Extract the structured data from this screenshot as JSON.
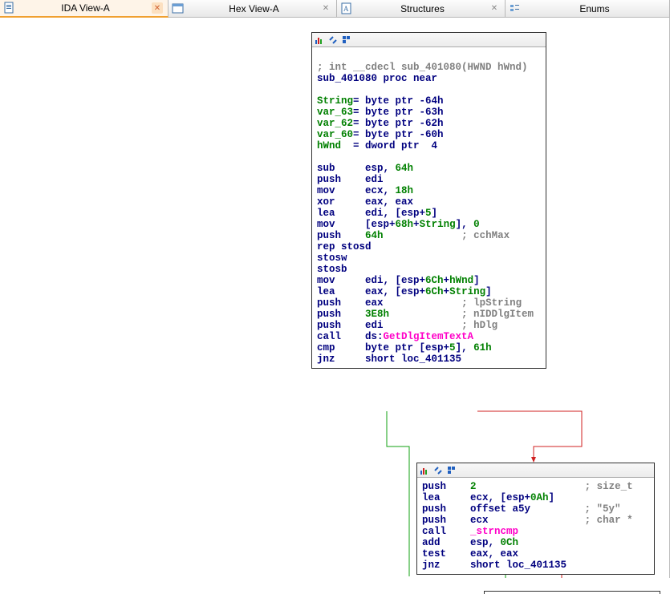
{
  "tabs": [
    {
      "label": "IDA View-A",
      "active": true
    },
    {
      "label": "Hex View-A",
      "active": false
    },
    {
      "label": "Structures",
      "active": false
    },
    {
      "label": "Enums",
      "active": false
    }
  ],
  "node1": {
    "sig_comment": "; int __cdecl sub_401080(HWND hWnd)",
    "proc_decl": "sub_401080 proc near",
    "vars": [
      {
        "name": "String",
        "eq": "= byte ptr -64h"
      },
      {
        "name": "var_63",
        "eq": "= byte ptr -63h"
      },
      {
        "name": "var_62",
        "eq": "= byte ptr -62h"
      },
      {
        "name": "var_60",
        "eq": "= byte ptr -60h"
      },
      {
        "name": "hWnd",
        "eq": "= dword ptr  4"
      }
    ],
    "lines": [
      {
        "m": "sub",
        "o": "esp, ",
        "n": "64h"
      },
      {
        "m": "push",
        "o": "edi"
      },
      {
        "m": "mov",
        "o": "ecx, ",
        "n": "18h"
      },
      {
        "m": "xor",
        "o": "eax, eax"
      },
      {
        "m": "lea",
        "o": "edi, [esp+",
        "n": "5",
        "o2": "]"
      },
      {
        "m": "mov",
        "o": "[esp+",
        "n": "68h",
        "o2": "+",
        "v": "String",
        "o3": "], ",
        "n2": "0"
      },
      {
        "m": "push",
        "n": "64h",
        "cmt": "; cchMax"
      },
      {
        "m": "rep stosd"
      },
      {
        "m": "stosw"
      },
      {
        "m": "stosb"
      },
      {
        "m": "mov",
        "o": "edi, [esp+",
        "n": "6Ch",
        "o2": "+",
        "v": "hWnd",
        "o3": "]"
      },
      {
        "m": "lea",
        "o": "eax, [esp+",
        "n": "6Ch",
        "o2": "+",
        "v": "String",
        "o3": "]"
      },
      {
        "m": "push",
        "o": "eax",
        "cmt": "; lpString"
      },
      {
        "m": "push",
        "n": "3E8h",
        "cmt": "; nIDDlgItem"
      },
      {
        "m": "push",
        "o": "edi",
        "cmt": "; hDlg"
      },
      {
        "m": "call",
        "o": "ds:",
        "fn": "GetDlgItemTextA"
      },
      {
        "m": "cmp",
        "o": "byte ptr [esp+",
        "n": "5",
        "o2": "], ",
        "n2": "61h"
      },
      {
        "m": "jnz",
        "o": "short loc_401135"
      }
    ]
  },
  "node2": {
    "lines": [
      {
        "m": "push",
        "n": "2",
        "cmt": "; size_t"
      },
      {
        "m": "lea",
        "o": "ecx, [esp+",
        "n": "0Ah",
        "o2": "]"
      },
      {
        "m": "push",
        "o": "offset a5y",
        "cmt2": "; \"5y\""
      },
      {
        "m": "push",
        "o": "ecx",
        "cmt": "; char *"
      },
      {
        "m": "call",
        "fn2": "_strncmp"
      },
      {
        "m": "add",
        "o": "esp, ",
        "n": "0Ch"
      },
      {
        "m": "test",
        "o": "eax, eax"
      },
      {
        "m": "jnz",
        "o": "short loc_401135"
      }
    ]
  }
}
